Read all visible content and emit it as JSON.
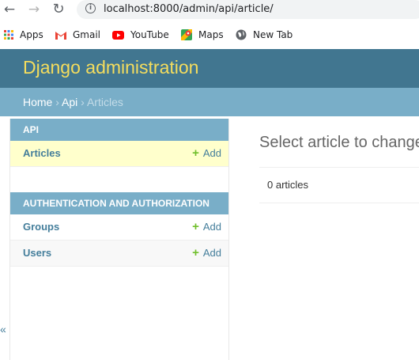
{
  "browser": {
    "url": "localhost:8000/admin/api/article/",
    "bookmarks": [
      "Apps",
      "Gmail",
      "YouTube",
      "Maps",
      "New Tab"
    ]
  },
  "header": {
    "branding": "Django administration"
  },
  "breadcrumbs": {
    "home": "Home",
    "app": "Api",
    "current": "Articles",
    "separator": "›"
  },
  "sidebar": {
    "modules": [
      {
        "caption": "API",
        "models": [
          {
            "name": "Articles",
            "add_label": "Add",
            "selected": true
          }
        ]
      },
      {
        "caption": "AUTHENTICATION AND AUTHORIZATION",
        "models": [
          {
            "name": "Groups",
            "add_label": "Add"
          },
          {
            "name": "Users",
            "add_label": "Add"
          }
        ]
      }
    ],
    "collapse_glyph": "«"
  },
  "content": {
    "title": "Select article to change",
    "paginator": "0 articles"
  },
  "colors": {
    "header_bg": "#417690",
    "branding": "#f5dd5d",
    "breadcrumbs_bg": "#79aec8",
    "link": "#447e9b",
    "add_icon": "#70bf2b",
    "selected_row": "#ffffcc"
  }
}
